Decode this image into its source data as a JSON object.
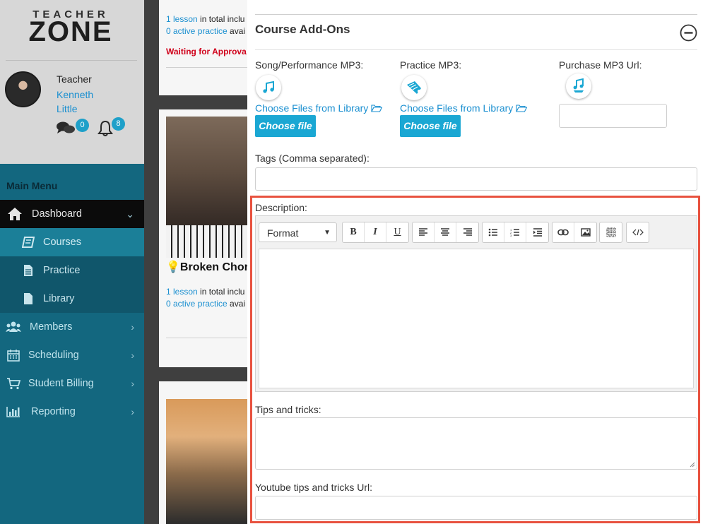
{
  "brand": {
    "line1": "TEACHER",
    "line2": "ZONE"
  },
  "user": {
    "role": "Teacher",
    "first_name": "Kenneth",
    "last_name": "Little",
    "messages_count": "0",
    "notifications_count": "8"
  },
  "menu": {
    "title": "Main Menu",
    "dashboard": "Dashboard",
    "courses": "Courses",
    "practice": "Practice",
    "library": "Library",
    "members": "Members",
    "scheduling": "Scheduling",
    "student_billing": "Student Billing",
    "reporting": "Reporting"
  },
  "bg_cards": {
    "card1": {
      "lessons_link": "1 lesson",
      "lessons_text": " in total inclu",
      "practice_link": "0 active practice",
      "practice_text": " avai",
      "status": "Waiting for Approva"
    },
    "card2": {
      "title": "Broken Chor",
      "lessons_link": "1 lesson",
      "lessons_text": " in total inclu",
      "practice_link": "0 active practice",
      "practice_text": " avai"
    }
  },
  "addons": {
    "title": "Course Add-Ons",
    "song_label": "Song/Performance MP3:",
    "practice_label": "Practice MP3:",
    "purchase_label": "Purchase MP3 Url:",
    "choose_library": "Choose Files from Library",
    "choose_file": "Choose file",
    "tags_label": "Tags (Comma separated):",
    "description_label": "Description:",
    "format": "Format",
    "tips_label": "Tips and tricks:",
    "youtube_label": "Youtube tips and tricks Url:"
  },
  "colors": {
    "accent": "#1aa7d3",
    "sidebar": "#13677f",
    "link": "#1a8fd0",
    "highlight": "#e8523f",
    "warning": "#d0021b"
  }
}
